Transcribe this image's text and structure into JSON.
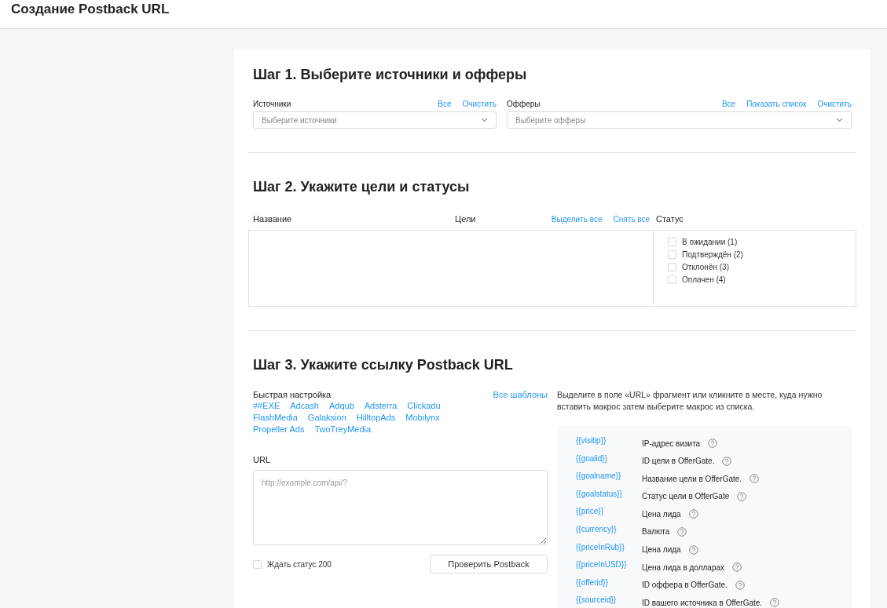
{
  "page_title": "Создание Postback URL",
  "step1": {
    "title": "Шаг 1. Выберите источники и офферы",
    "sources": {
      "label": "Источники",
      "links": [
        "Все",
        "Очистить"
      ],
      "placeholder": "Выберите источники"
    },
    "offers": {
      "label": "Офферы",
      "links": [
        "Все",
        "Показать список",
        "Очистить"
      ],
      "placeholder": "Выберите офферы"
    }
  },
  "step2": {
    "title": "Шаг 2. Укажите цели и статусы",
    "columns": {
      "name": "Название",
      "goals": "Цели",
      "status": "Статус"
    },
    "goal_links": [
      "Выделить все",
      "Снять все"
    ],
    "statuses": [
      {
        "label": "В ожидании (1)",
        "checked": false
      },
      {
        "label": "Подтверждён (2)",
        "checked": false
      },
      {
        "label": "Отклонён (3)",
        "checked": false
      },
      {
        "label": "Оплачен (4)",
        "checked": false
      }
    ]
  },
  "step3": {
    "title": "Шаг 3. Укажите ссылку Postback URL",
    "quick_setup": {
      "label": "Быстрая настройка",
      "all_link": "Все шаблоны",
      "templates": [
        [
          "##EXE",
          "Adcash",
          "Adqub",
          "Adsterra",
          "Clickadu"
        ],
        [
          "FlashMedia",
          "Galaksion",
          "HilltopAds",
          "Mobilynx"
        ],
        [
          "Propeller Ads",
          "TwoTreyMedia"
        ]
      ]
    },
    "url": {
      "label": "URL",
      "placeholder": "http://example.com/api/?"
    },
    "wait_status": {
      "label": "Ждать статус 200",
      "checked": false
    },
    "check_button": "Проверить Postback",
    "hint": "Выделите в поле «URL» фрагмент или кликните в месте, куда нужно вставить макрос затем выберите макрос из списка.",
    "macros": [
      {
        "macro": "{{visitip}}",
        "description": "IP-адрес визита"
      },
      {
        "macro": "{{goalid}}",
        "description": "ID цели в OfferGate."
      },
      {
        "macro": "{{goalname}}",
        "description": "Название цели в OfferGate."
      },
      {
        "macro": "{{goalstatus}}",
        "description": "Статус цели в OfferGate"
      },
      {
        "macro": "{{price}}",
        "description": "Цена лида"
      },
      {
        "macro": "{{currency}}",
        "description": "Валюта"
      },
      {
        "macro": "{{priceInRub}}",
        "description": "Цена лида"
      },
      {
        "macro": "{{priceInUSD}}",
        "description": "Цена лида в долларах"
      },
      {
        "macro": "{{offerid}}",
        "description": "ID оффера в OfferGate."
      },
      {
        "macro": "{{sourceid}}",
        "description": "ID вашего источника в OfferGate."
      }
    ]
  }
}
